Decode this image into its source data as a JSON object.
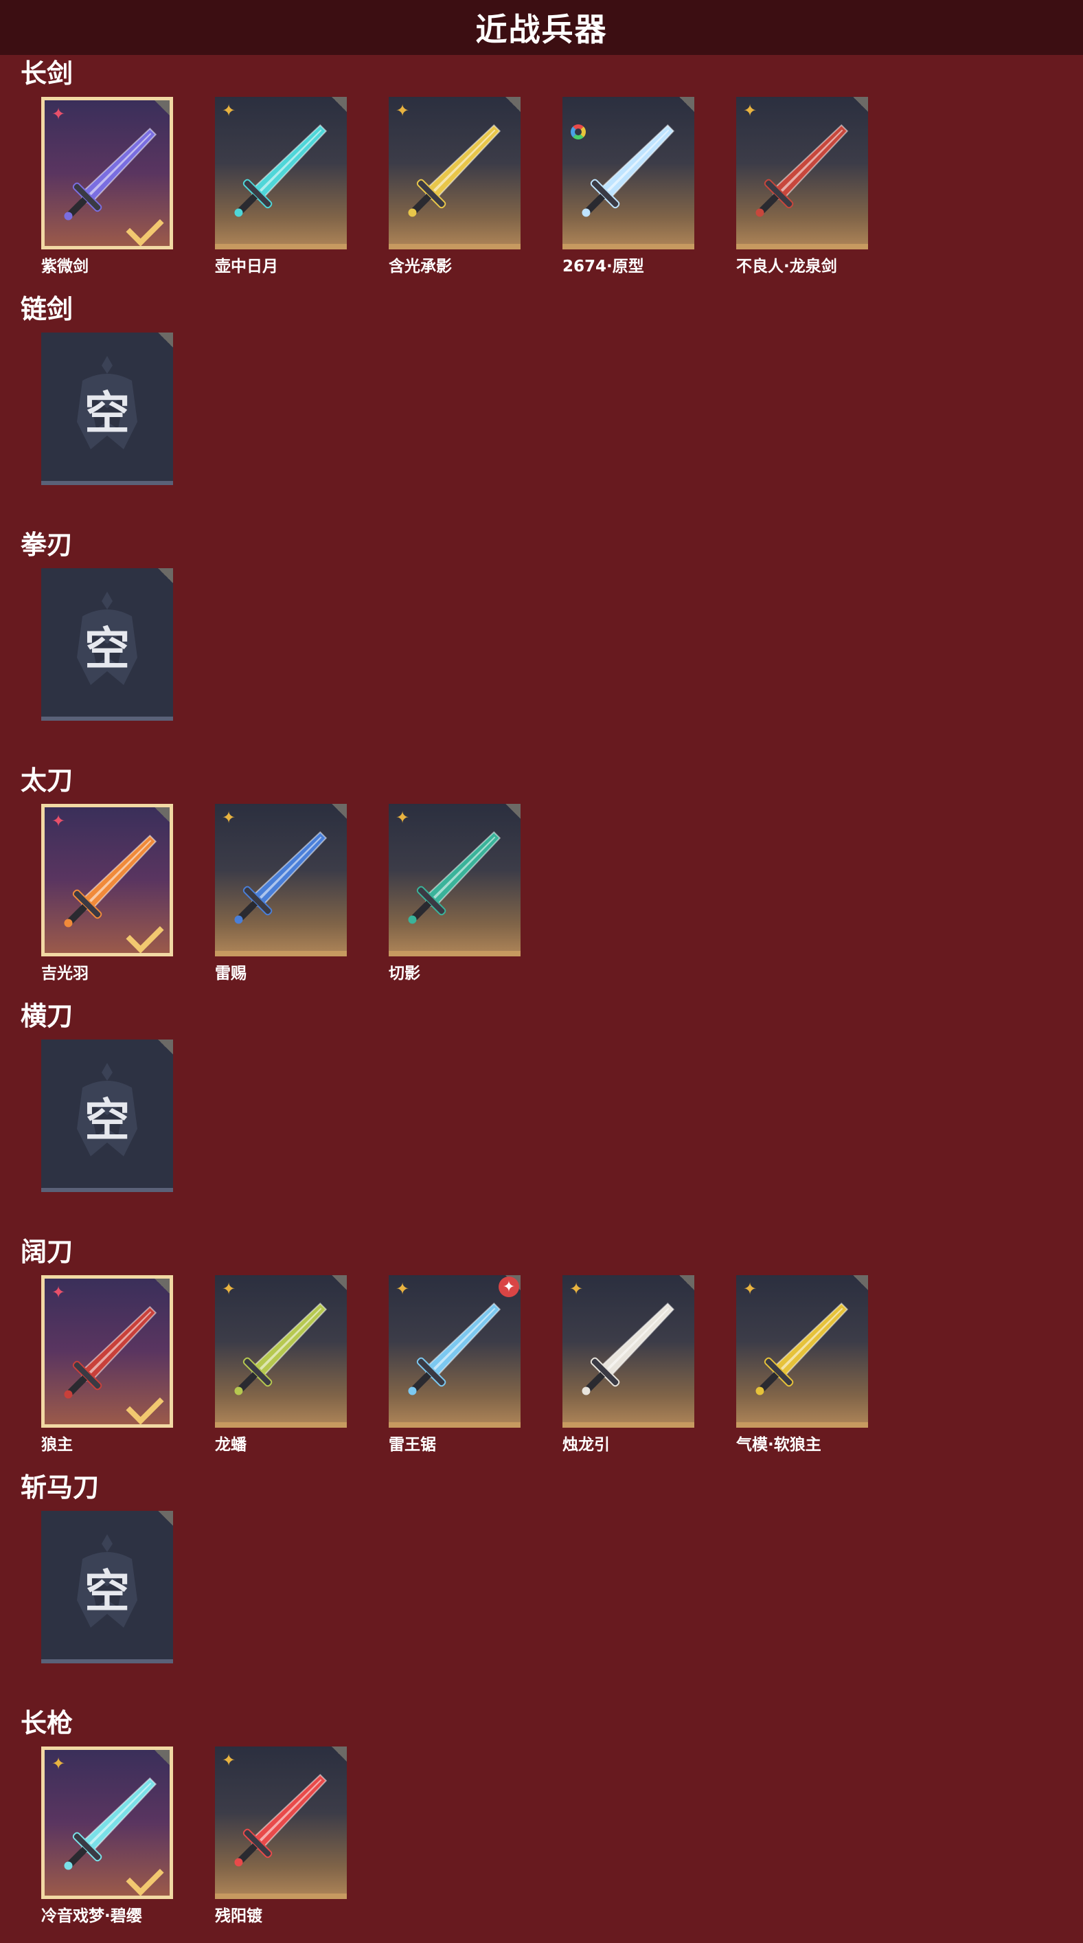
{
  "header": {
    "title": "近战兵器"
  },
  "sections": [
    {
      "title": "长剑",
      "items": [
        {
          "name": "紫微剑",
          "rarity": "red",
          "equipped": true,
          "icon": "purple-sword-icon",
          "color": "#7a6ee0"
        },
        {
          "name": "壶中日月",
          "rarity": "gold",
          "icon": "cyan-sword-icon",
          "color": "#4fd6d8"
        },
        {
          "name": "含光承影",
          "rarity": "gold",
          "icon": "golden-sword-icon",
          "color": "#e8c64a"
        },
        {
          "name": "2674·原型",
          "rarity": "ring",
          "icon": "light-blade-icon",
          "color": "#bfe4ff"
        },
        {
          "name": "不良人·龙泉剑",
          "rarity": "gold",
          "icon": "dark-sword-icon",
          "color": "#c7473c"
        }
      ]
    },
    {
      "title": "链剑",
      "items": [
        {
          "empty": true,
          "empty_text": "空"
        }
      ]
    },
    {
      "title": "拳刃",
      "items": [
        {
          "empty": true,
          "empty_text": "空"
        }
      ]
    },
    {
      "title": "太刀",
      "items": [
        {
          "name": "吉光羽",
          "rarity": "red",
          "equipped": true,
          "icon": "flame-blade-icon",
          "color": "#f08a3a"
        },
        {
          "name": "雷赐",
          "rarity": "gold",
          "icon": "thunder-blade-icon",
          "color": "#4a7fd8"
        },
        {
          "name": "切影",
          "rarity": "gold",
          "icon": "shadow-blade-icon",
          "color": "#3ab39a"
        }
      ]
    },
    {
      "title": "横刀",
      "items": [
        {
          "empty": true,
          "empty_text": "空"
        }
      ]
    },
    {
      "title": "阔刀",
      "items": [
        {
          "name": "狼主",
          "rarity": "red",
          "equipped": true,
          "icon": "wolf-broadsword-icon",
          "color": "#c8403a"
        },
        {
          "name": "龙蟠",
          "rarity": "gold",
          "icon": "dragon-broadsword-icon",
          "color": "#b6c850"
        },
        {
          "name": "雷王锯",
          "rarity": "gold",
          "badge": "red",
          "icon": "saw-broadsword-icon",
          "color": "#7cc8f0"
        },
        {
          "name": "烛龙引",
          "rarity": "gold",
          "icon": "white-dragon-broadsword-icon",
          "color": "#e8e4dc"
        },
        {
          "name": "气模·软狼主",
          "rarity": "gold",
          "icon": "yellow-broadsword-icon",
          "color": "#e6c23a"
        }
      ]
    },
    {
      "title": "斩马刀",
      "items": [
        {
          "empty": true,
          "empty_text": "空"
        }
      ]
    },
    {
      "title": "长枪",
      "items": [
        {
          "name": "冷音戏梦·碧缨",
          "rarity": "gold",
          "equipped": true,
          "icon": "ice-spear-icon",
          "color": "#7ae0e8"
        },
        {
          "name": "残阳镀",
          "rarity": "gold",
          "icon": "crimson-spear-icon",
          "color": "#e84a4a"
        }
      ]
    }
  ]
}
